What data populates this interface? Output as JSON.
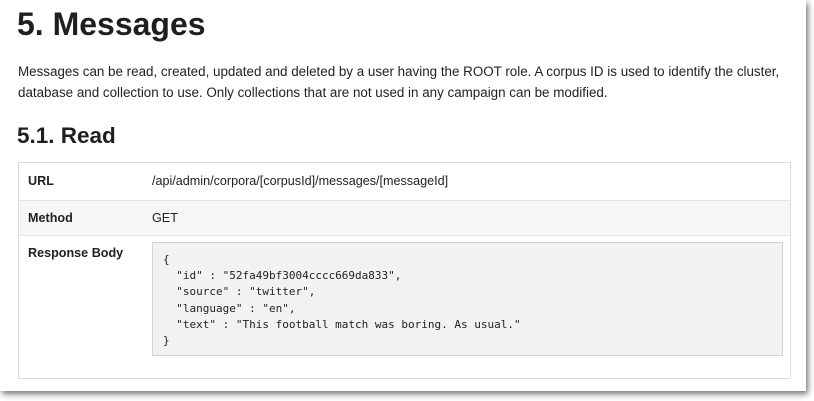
{
  "section": {
    "title": "5. Messages",
    "intro": "Messages can be read, created, updated and deleted by a user having the ROOT role. A corpus ID is used to identify the cluster, database and collection to use. Only collections that are not used in any campaign can be modified."
  },
  "subsection": {
    "title": "5.1. Read"
  },
  "table": {
    "url_label": "URL",
    "url_value": "/api/admin/corpora/[corpusId]/messages/[messageId]",
    "method_label": "Method",
    "method_value": "GET",
    "response_label": "Response Body",
    "response_lines": [
      "{",
      "  \"id\" : \"52fa49bf3004cccc669da833\",",
      "  \"source\" : \"twitter\",",
      "  \"language\" : \"en\",",
      "  \"text\" : \"This football match was boring. As usual.\"",
      "}"
    ]
  }
}
